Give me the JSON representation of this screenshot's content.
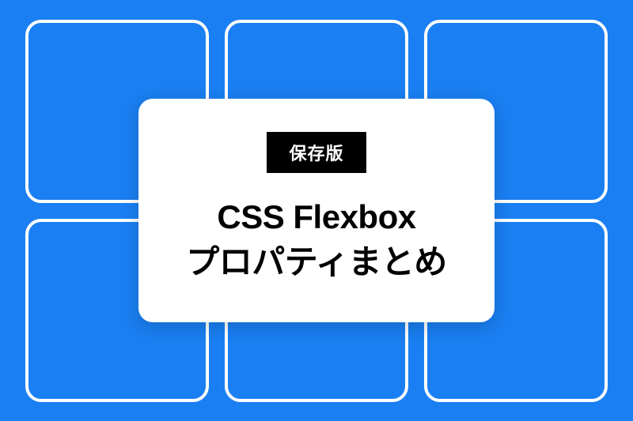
{
  "colors": {
    "background": "#1a7ff2",
    "card": "#ffffff",
    "badge_bg": "#000000",
    "badge_text": "#ffffff",
    "title": "#000000",
    "grid_border": "#ffffff"
  },
  "badge": {
    "label": "保存版"
  },
  "title": {
    "line1": "CSS Flexbox",
    "line2": "プロパティまとめ"
  },
  "grid": {
    "cell_count": 6
  }
}
